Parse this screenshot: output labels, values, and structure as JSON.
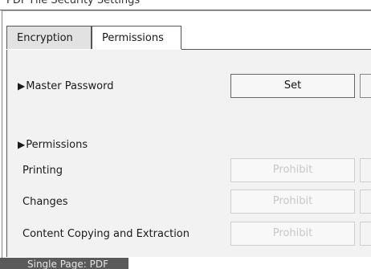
{
  "window": {
    "title": "PDF File Security Settings"
  },
  "tabs": [
    {
      "label": "Encryption",
      "active": false
    },
    {
      "label": "Permissions",
      "active": true
    }
  ],
  "master_password": {
    "label": "Master Password",
    "button": "Set"
  },
  "permissions": {
    "heading": "Permissions",
    "rows": [
      {
        "label": "Printing",
        "button": "Prohibit"
      },
      {
        "label": "Changes",
        "button": "Prohibit"
      },
      {
        "label": "Content Copying and Extraction",
        "button": "Prohibit"
      }
    ]
  },
  "status": {
    "text": "Single Page: PDF"
  }
}
